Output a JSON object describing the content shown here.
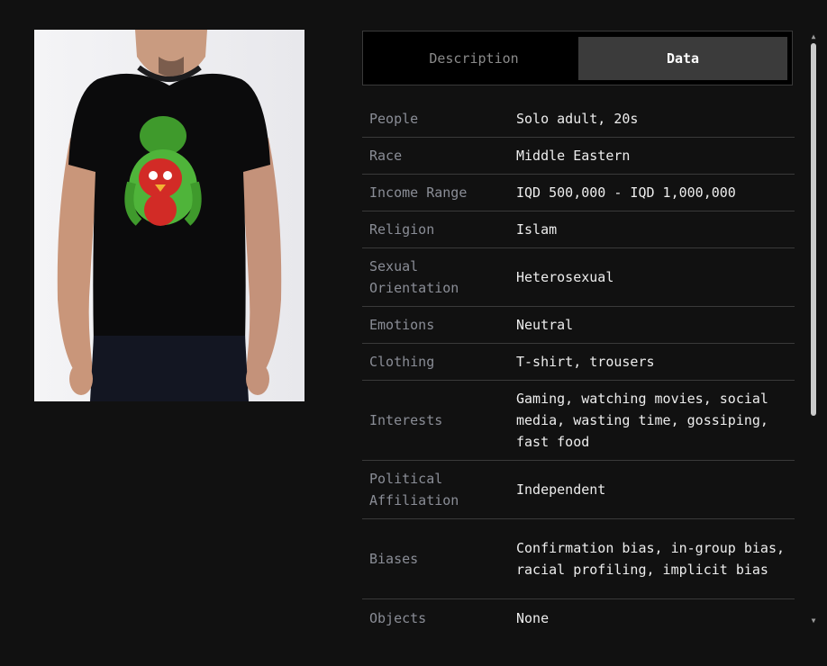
{
  "tabs": {
    "description_label": "Description",
    "data_label": "Data",
    "active": "Data"
  },
  "photo": {
    "alt": "Young man wearing a black t-shirt with an Angry Birds graphic"
  },
  "rows": [
    {
      "key": "People",
      "value": "Solo adult, 20s"
    },
    {
      "key": "Race",
      "value": "Middle Eastern"
    },
    {
      "key": "Income Range",
      "value": "IQD 500,000 - IQD 1,000,000"
    },
    {
      "key": "Religion",
      "value": "Islam"
    },
    {
      "key": "Sexual Orientation",
      "value": "Heterosexual"
    },
    {
      "key": "Emotions",
      "value": "Neutral"
    },
    {
      "key": "Clothing",
      "value": "T-shirt, trousers"
    },
    {
      "key": "Interests",
      "value": "Gaming, watching movies, social media, wasting time, gossiping, fast food"
    },
    {
      "key": "Political Affiliation",
      "value": "Independent"
    },
    {
      "key": "Biases",
      "value": "Confirmation bias, in-group bias, racial profiling, implicit bias"
    },
    {
      "key": "Objects",
      "value": "None"
    }
  ],
  "scrollbar": {
    "up_icon": "▲",
    "down_icon": "▼"
  }
}
